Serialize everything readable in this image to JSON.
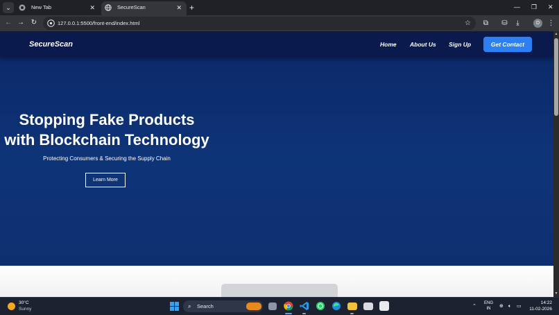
{
  "browser": {
    "tabs": [
      {
        "title": "New Tab",
        "active": false
      },
      {
        "title": "SecureScan",
        "active": true
      }
    ],
    "new_tab_glyph": "+",
    "close_glyph": "✕",
    "window_controls": {
      "minimize": "—",
      "maximize": "❐",
      "close": "✕"
    },
    "address_bar": {
      "url": "127.0.0.1:5500/front-end/index.html"
    },
    "profile_initial": "D"
  },
  "site": {
    "logo": "SecureScan",
    "nav": [
      "Home",
      "About Us",
      "Sign Up"
    ],
    "cta_label": "Get Contact",
    "hero": {
      "title_line1": "Stopping Fake Products",
      "title_line2": "with Blockchain Technology",
      "subtitle": "Protecting Consumers & Securing the Supply Chain",
      "button_label": "Learn More"
    },
    "colors": {
      "header_bg": "#0a1a4c",
      "hero_bg": "#0e3478",
      "cta_bg": "#2c80f3"
    }
  },
  "taskbar": {
    "weather": {
      "temp": "30°C",
      "condition": "Sunny"
    },
    "search_placeholder": "Search",
    "language": {
      "line1": "ENG",
      "line2": "IN"
    },
    "time": "14:22",
    "date": "11-02-2026",
    "pinned_apps": [
      "task-view-icon",
      "chrome-icon",
      "vscode-icon",
      "whatsapp-icon",
      "edge-icon",
      "file-explorer-icon",
      "mail-icon",
      "store-icon"
    ]
  }
}
